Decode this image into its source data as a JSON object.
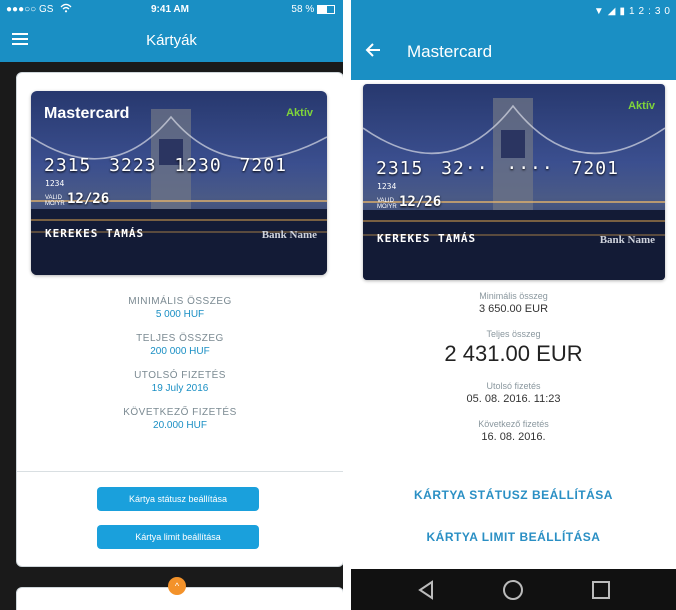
{
  "ios": {
    "status_bar": {
      "carrier": "●●●○○ GS",
      "time": "9:41 AM",
      "battery": "58 %"
    },
    "nav": {
      "title": "Kártyák"
    },
    "card": {
      "name": "Mastercard",
      "status": "Aktív",
      "number": "2315 3223 1230 7201",
      "sub_number": "1234",
      "valid_label_1": "VALID",
      "valid_label_2": "MO/YR",
      "expiry": "12/26",
      "holder": "KEREKES TAMÁS",
      "bank": "Bank Name"
    },
    "info": [
      {
        "label": "MINIMÁLIS ÖSSZEG",
        "value": "5 000 HUF"
      },
      {
        "label": "TELJES ÖSSZEG",
        "value": "200 000 HUF"
      },
      {
        "label": "UTOLSÓ FIZETÉS",
        "value": "19 July 2016"
      },
      {
        "label": "KÖVETKEZŐ FIZETÉS",
        "value": "20.000 HUF"
      }
    ],
    "buttons": {
      "status": "Kártya státusz beállítása",
      "limit": "Kártya limit beállítása"
    }
  },
  "android": {
    "status_bar": {
      "time": "12:30"
    },
    "toolbar": {
      "title": "Mastercard"
    },
    "card": {
      "status": "Aktív",
      "number": "2315 32·· ···· 7201",
      "sub_number": "1234",
      "valid_label_1": "VALID",
      "valid_label_2": "MO/YR",
      "expiry": "12/26",
      "holder": "KEREKES TAMÁS",
      "bank": "Bank Name"
    },
    "info": {
      "min_label": "Minimális összeg",
      "min_value": "3 650.00 EUR",
      "total_label": "Teljes összeg",
      "total_value": "2 431.00 EUR",
      "last_label": "Utolsó fizetés",
      "last_value": "05. 08. 2016. 11:23",
      "next_label": "Következő fizetés",
      "next_value": "16. 08. 2016."
    },
    "links": {
      "status": "KÁRTYA STÁTUSZ BEÁLLÍTÁSA",
      "limit": "KÁRTYA LIMIT BEÁLLÍTÁSA"
    }
  },
  "colors": {
    "primary": "#1a8fc4",
    "button": "#1aa0dc",
    "active": "#7fd43a",
    "accent_orange": "#f3922a"
  },
  "icons": [
    "wifi-icon",
    "battery-icon",
    "hamburger-menu-icon",
    "back-arrow-icon",
    "signal-icon",
    "nav-back-icon",
    "nav-home-icon",
    "nav-recents-icon",
    "chevron-up-icon"
  ]
}
